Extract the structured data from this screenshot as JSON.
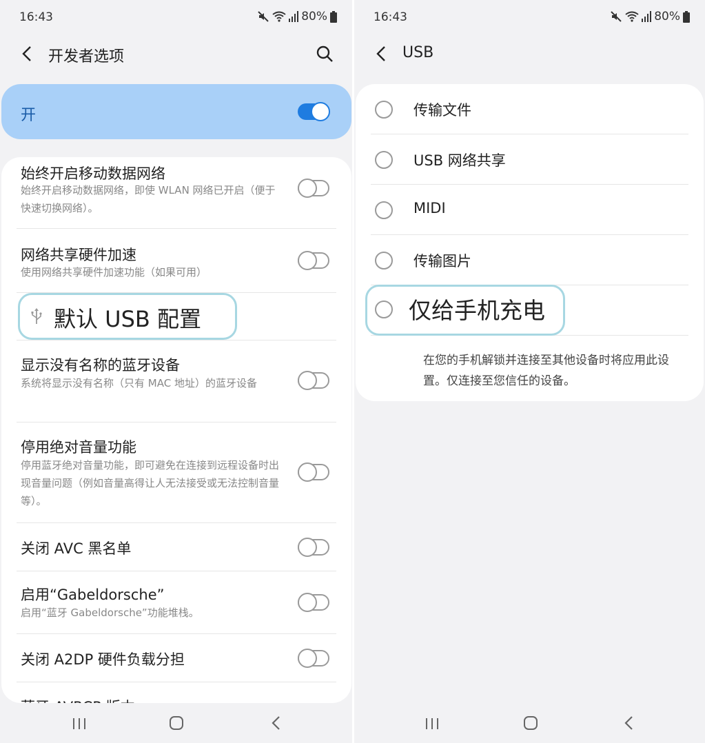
{
  "left": {
    "status": {
      "time": "16:43",
      "battery": "80%"
    },
    "header": {
      "title": "开发者选项"
    },
    "master": {
      "label": "开"
    },
    "settings": [
      {
        "title": "始终开启移动数据网络",
        "sub": "始终开启移动数据网络，即使 WLAN 网络已开启（便于快速切换网络）。"
      },
      {
        "title": "网络共享硬件加速",
        "sub": "使用网络共享硬件加速功能（如果可用）"
      },
      {
        "title": "显示没有名称的蓝牙设备",
        "sub": "系统将显示没有名称（只有 MAC 地址）的蓝牙设备"
      },
      {
        "title": "停用绝对音量功能",
        "sub": "停用蓝牙绝对音量功能，即可避免在连接到远程设备时出现音量问题（例如音量高得让人无法接受或无法控制音量等）。"
      },
      {
        "title": "关闭 AVC 黑名单",
        "sub": ""
      },
      {
        "title": "启用“Gabeldorsche”",
        "sub": "启用“蓝牙 Gabeldorsche”功能堆栈。"
      },
      {
        "title": "关闭 A2DP 硬件负载分担",
        "sub": ""
      },
      {
        "title": "蓝牙 AVRCP 版本",
        "sub": ""
      }
    ],
    "usb_default": {
      "label": "默认 USB 配置"
    }
  },
  "right": {
    "status": {
      "time": "16:43",
      "battery": "80%"
    },
    "header": {
      "title": "USB"
    },
    "options": [
      {
        "label": "传输文件"
      },
      {
        "label": "USB 网络共享"
      },
      {
        "label": "MIDI"
      },
      {
        "label": "传输图片"
      },
      {
        "label": "仅给手机充电"
      }
    ],
    "note": "在您的手机解锁并连接至其他设备时将应用此设置。仅连接至您信任的设备。"
  },
  "colors": {
    "accent": "#1f7ce0",
    "master_bg": "#a9d0f8",
    "highlight": "#a7d7e2"
  },
  "icons": [
    "back-icon",
    "search-icon",
    "usb-icon",
    "mute-icon",
    "wifi-icon",
    "signal-icon",
    "battery-icon",
    "recents-icon",
    "home-icon",
    "nav-back-icon"
  ]
}
